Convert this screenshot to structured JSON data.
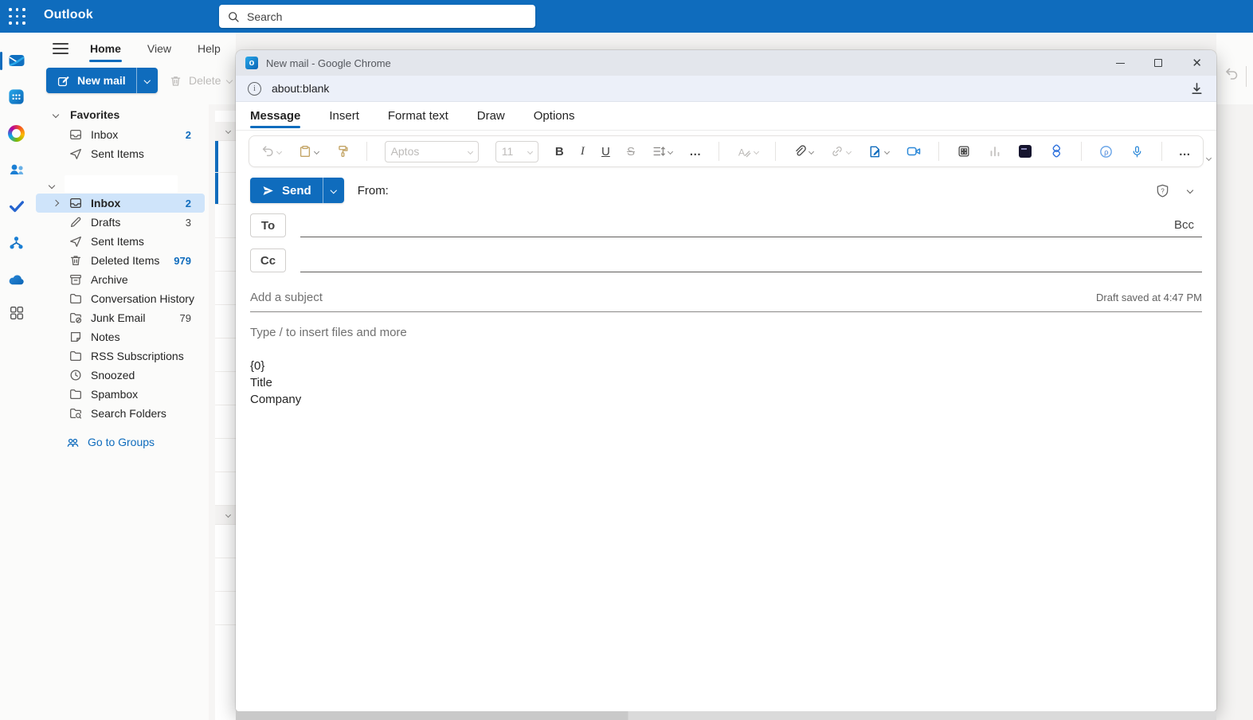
{
  "colors": {
    "accent": "#0f6cbd",
    "selected_row": "#cfe4fa",
    "title_bar": "#e3e6ec",
    "unread_badge": "#0f6cbd"
  },
  "topbar": {
    "app_title": "Outlook",
    "search_placeholder": "Search"
  },
  "rail": {
    "icons": [
      "mail",
      "calendar",
      "copilot",
      "people",
      "todo",
      "org-chart",
      "onedrive",
      "more-apps"
    ]
  },
  "ribbon": {
    "tabs": [
      {
        "label": "Home"
      },
      {
        "label": "View"
      },
      {
        "label": "Help"
      }
    ],
    "active_tab": "Home",
    "new_mail_label": "New mail",
    "delete_label": "Delete"
  },
  "sidebar": {
    "favorites_label": "Favorites",
    "favorites": [
      {
        "label": "Inbox",
        "count": "2"
      },
      {
        "label": "Sent Items",
        "count": ""
      }
    ],
    "folders": [
      {
        "label": "Inbox",
        "count": "2"
      },
      {
        "label": "Drafts",
        "count": "3"
      },
      {
        "label": "Sent Items",
        "count": ""
      },
      {
        "label": "Deleted Items",
        "count": "979"
      },
      {
        "label": "Archive",
        "count": ""
      },
      {
        "label": "Conversation History",
        "count": ""
      },
      {
        "label": "Junk Email",
        "count": "79"
      },
      {
        "label": "Notes",
        "count": ""
      },
      {
        "label": "RSS Subscriptions",
        "count": ""
      },
      {
        "label": "Snoozed",
        "count": ""
      },
      {
        "label": "Spambox",
        "count": ""
      },
      {
        "label": "Search Folders",
        "count": ""
      }
    ],
    "go_to_groups_label": "Go to Groups"
  },
  "popup": {
    "window_title": "New mail - Google Chrome",
    "url": "about:blank",
    "favicon_letter": "o",
    "tabs": [
      {
        "label": "Message"
      },
      {
        "label": "Insert"
      },
      {
        "label": "Format text"
      },
      {
        "label": "Draw"
      },
      {
        "label": "Options"
      }
    ],
    "active_tab": "Message",
    "toolbar": {
      "font_name": "Aptos",
      "font_size": "11",
      "bold": "B",
      "italic": "I",
      "underline": "U",
      "strikethrough": "S",
      "more": "…",
      "icons": [
        "undo",
        "paste",
        "format-painter",
        "bold",
        "italic",
        "underline",
        "strikethrough",
        "line-spacing",
        "more",
        "text-effects",
        "attach",
        "link",
        "signature",
        "video",
        "table",
        "chart",
        "loop",
        "designer",
        "insights",
        "dictate",
        "overflow"
      ]
    },
    "compose": {
      "send_label": "Send",
      "from_label": "From:",
      "to_label": "To",
      "cc_label": "Cc",
      "bcc_label": "Bcc",
      "subject_placeholder": "Add a subject",
      "draft_status": "Draft saved at 4:47 PM",
      "body_placeholder": "Type / to insert files and more",
      "body_lines": [
        "{0}",
        "Title",
        "Company"
      ]
    }
  }
}
